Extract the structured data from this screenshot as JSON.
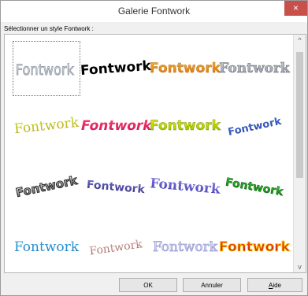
{
  "window": {
    "title": "Galerie Fontwork",
    "close_glyph": "×"
  },
  "gallery": {
    "label": "Sélectionner un style Fontwork :",
    "items": [
      {
        "text": "Fontwork",
        "style": "outline-rotated",
        "colors": [
          "#ffffff",
          "#9fa6b5"
        ]
      },
      {
        "text": "Fontwork",
        "style": "bold-black",
        "colors": [
          "#000000",
          "#000000"
        ]
      },
      {
        "text": "Fontwork",
        "style": "gold-gradient",
        "colors": [
          "#f4b32a",
          "#d86d1e"
        ]
      },
      {
        "text": "Fontwork",
        "style": "silver-gradient",
        "colors": [
          "#c8ccd8",
          "#8e96a8"
        ]
      },
      {
        "text": "Fontwork",
        "style": "green-yellow",
        "colors": [
          "#bfe01d",
          "#c09a24"
        ]
      },
      {
        "text": "Fontwork",
        "style": "pink-perspective",
        "colors": [
          "#ff3c73",
          "#c4174f"
        ]
      },
      {
        "text": "Fontwork",
        "style": "yellow-green",
        "colors": [
          "#f0f000",
          "#8bbb00"
        ]
      },
      {
        "text": "Fontwork",
        "style": "blue-slant",
        "colors": [
          "#426fd1",
          "#2e3f9e"
        ]
      },
      {
        "text": "Fontwork",
        "style": "dark-outline-slant",
        "colors": [
          "#eeeeee",
          "#444444"
        ]
      },
      {
        "text": "Fontwork",
        "style": "blue-violet-bold",
        "colors": [
          "#6b6fc7",
          "#3a2d80"
        ]
      },
      {
        "text": "Fontwork",
        "style": "violet-wave",
        "colors": [
          "#8a82e6",
          "#3f38ad"
        ]
      },
      {
        "text": "Fontwork",
        "style": "green-arc",
        "colors": [
          "#3ec33e",
          "#0b7a0b"
        ]
      },
      {
        "text": "Fontwork",
        "style": "cyan-wave",
        "colors": [
          "#35a8e8",
          "#1776b8"
        ]
      },
      {
        "text": "Fontwork",
        "style": "tan-arc",
        "colors": [
          "#d7a39b",
          "#8f5c55"
        ]
      },
      {
        "text": "Fontwork",
        "style": "lavender-outline",
        "colors": [
          "#f8f8ff",
          "#b5b7e6"
        ]
      },
      {
        "text": "Fontwork",
        "style": "red-gold-3d",
        "colors": [
          "#ff5a18",
          "#b31515"
        ]
      }
    ]
  },
  "buttons": {
    "ok": "OK",
    "cancel": "Annuler",
    "help_prefix": "A",
    "help_rest": "ide"
  },
  "scrollbar": {
    "up_glyph": "^",
    "down_glyph": "v"
  }
}
